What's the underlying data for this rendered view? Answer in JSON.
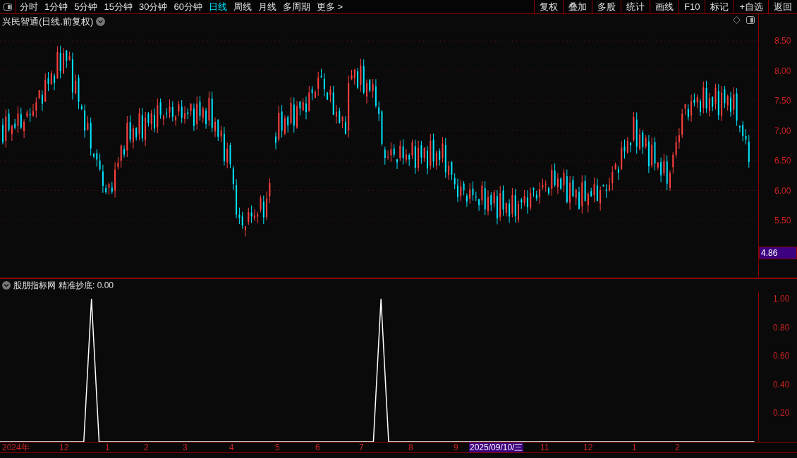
{
  "toolbar": {
    "periods": [
      {
        "label": "分时",
        "selected": false
      },
      {
        "label": "1分钟",
        "selected": false
      },
      {
        "label": "5分钟",
        "selected": false
      },
      {
        "label": "15分钟",
        "selected": false
      },
      {
        "label": "30分钟",
        "selected": false
      },
      {
        "label": "60分钟",
        "selected": false
      },
      {
        "label": "日线",
        "selected": true
      },
      {
        "label": "周线",
        "selected": false
      },
      {
        "label": "月线",
        "selected": false
      },
      {
        "label": "多周期",
        "selected": false
      }
    ],
    "more": "更多",
    "more_arrow": ">",
    "buttons": [
      "复权",
      "叠加",
      "多股",
      "统计",
      "画线",
      "F10",
      "标记",
      "+自选",
      "返回"
    ]
  },
  "price_panel": {
    "title": "兴民智通(日线.前复权)",
    "axis_labels": [
      "8.50",
      "8.00",
      "7.50",
      "7.00",
      "6.50",
      "6.00",
      "5.50"
    ],
    "current_marker": "4.86"
  },
  "indicator_panel": {
    "name": "股朋指标网",
    "reading": "精准抄底: 0.00",
    "chart_data": {
      "type": "line",
      "ylim": [
        0,
        1.05
      ],
      "yticks": [
        {
          "value": 0.2,
          "label": "0.20"
        },
        {
          "value": 0.4,
          "label": "0.40"
        },
        {
          "value": 0.6,
          "label": "0.60"
        },
        {
          "value": 0.8,
          "label": "0.80"
        },
        {
          "value": 1,
          "label": "1.00"
        }
      ],
      "series": [
        {
          "color": "#ffffff",
          "values": [
            0,
            0,
            0,
            0,
            0,
            0,
            0,
            0,
            0,
            0,
            0,
            0,
            1,
            0,
            0,
            0,
            0,
            0,
            0,
            0,
            0,
            0,
            0,
            0,
            0,
            0,
            0,
            0,
            0,
            0,
            0,
            0,
            0,
            0,
            0,
            0,
            0,
            0,
            0,
            0,
            0,
            0,
            0,
            0,
            0,
            0,
            0,
            0,
            0,
            0,
            1,
            0,
            0,
            0,
            0,
            0,
            0,
            0,
            0,
            0,
            0,
            0,
            0,
            0,
            0,
            0,
            0,
            0,
            0,
            0,
            0,
            0,
            0,
            0,
            0,
            0,
            0,
            0,
            0,
            0,
            0,
            0,
            0,
            0,
            0,
            0,
            0,
            0,
            0,
            0,
            0,
            0,
            0,
            0,
            0,
            0,
            0,
            0,
            0,
            0
          ]
        }
      ]
    }
  },
  "time_axis": [
    {
      "label": "2024年",
      "selected": false
    },
    {
      "label": "12",
      "selected": false
    },
    {
      "label": "1",
      "selected": false
    },
    {
      "label": "2",
      "selected": false
    },
    {
      "label": "3",
      "selected": false
    },
    {
      "label": "4",
      "selected": false
    },
    {
      "label": "5",
      "selected": false
    },
    {
      "label": "6",
      "selected": false
    },
    {
      "label": "7",
      "selected": false
    },
    {
      "label": "8",
      "selected": false
    },
    {
      "label": "9",
      "selected": false
    },
    {
      "label": "2025/09/10/三",
      "selected": true
    },
    {
      "label": "11",
      "selected": false
    },
    {
      "label": "12",
      "selected": false
    },
    {
      "label": "1",
      "selected": false
    },
    {
      "label": "2",
      "selected": false
    }
  ]
}
